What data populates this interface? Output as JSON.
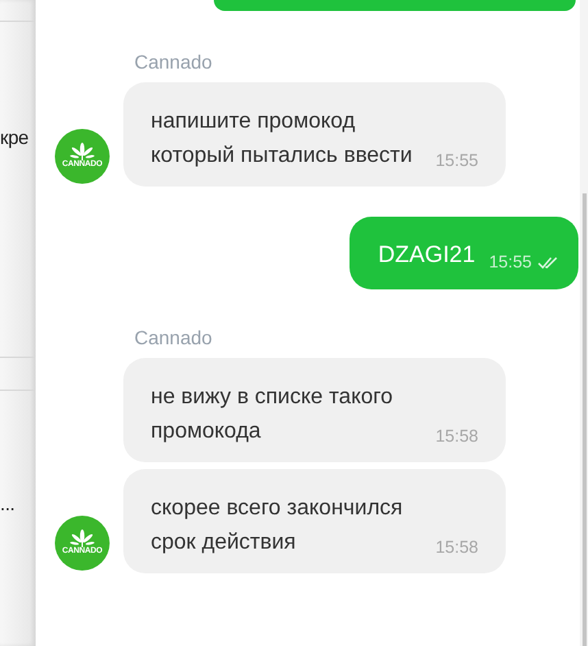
{
  "sidebar": {
    "items": [
      {
        "text": "кре"
      },
      {
        "text": "..."
      }
    ]
  },
  "messages": [
    {
      "kind": "clipped"
    },
    {
      "kind": "sender",
      "name": "Cannado"
    },
    {
      "kind": "incoming",
      "lines": [
        "напишите промокод",
        "который пытались ввести"
      ],
      "time": "15:55",
      "avatar": {
        "label": "CANNADO"
      }
    },
    {
      "kind": "outgoing",
      "lines": [
        "DZAGI21"
      ],
      "time": "15:55",
      "read": true
    },
    {
      "kind": "sender",
      "name": "Cannado"
    },
    {
      "kind": "incoming",
      "lines": [
        "не вижу в списке такого",
        "промокода"
      ],
      "time": "15:58"
    },
    {
      "kind": "incoming",
      "lines": [
        "скорее всего закончился",
        "срок действия"
      ],
      "time": "15:58",
      "avatar": {
        "label": "CANNADO"
      }
    }
  ]
}
